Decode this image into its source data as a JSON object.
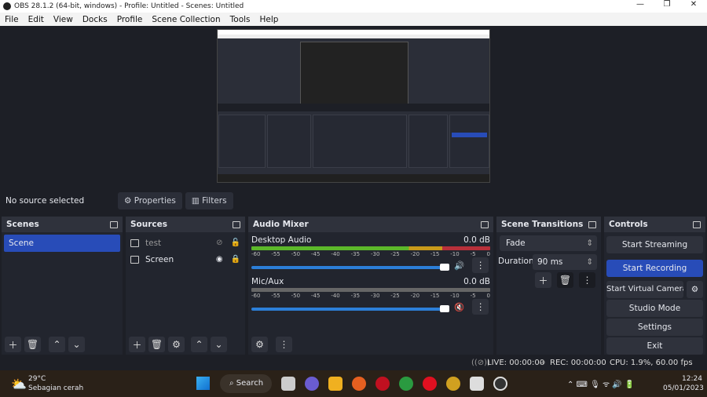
{
  "window": {
    "title": "OBS 28.1.2 (64-bit, windows) - Profile: Untitled - Scenes: Untitled",
    "controls": [
      "—",
      "❐",
      "✕"
    ]
  },
  "menu": [
    "File",
    "Edit",
    "View",
    "Docks",
    "Profile",
    "Scene Collection",
    "Tools",
    "Help"
  ],
  "source_toolbar": {
    "status": "No source selected",
    "properties": "Properties",
    "filters": "Filters"
  },
  "scenes": {
    "title": "Scenes",
    "items": [
      "Scene"
    ]
  },
  "sources": {
    "title": "Sources",
    "items": [
      {
        "name": "test",
        "visible": false,
        "locked": false
      },
      {
        "name": "Screen",
        "visible": true,
        "locked": true
      }
    ]
  },
  "audio_mixer": {
    "title": "Audio Mixer",
    "channels": [
      {
        "name": "Desktop Audio",
        "db": "0.0 dB",
        "muted": false
      },
      {
        "name": "Mic/Aux",
        "db": "0.0 dB",
        "muted": true
      }
    ],
    "ticks": [
      "-60",
      "-55",
      "-50",
      "-45",
      "-40",
      "-35",
      "-30",
      "-25",
      "-20",
      "-15",
      "-10",
      "-5",
      "0"
    ]
  },
  "transitions": {
    "title": "Scene Transitions",
    "selected": "Fade",
    "duration_label": "Duration",
    "duration": "90 ms"
  },
  "controls": {
    "title": "Controls",
    "buttons": [
      "Start Streaming",
      "Start Recording",
      "Start Virtual Camera",
      "Studio Mode",
      "Settings",
      "Exit"
    ],
    "accent": "#284cb8"
  },
  "status": {
    "live": "LIVE: 00:00:00",
    "rec": "REC: 00:00:00",
    "cpu": "CPU: 1.9%, 60.00 fps"
  },
  "taskbar": {
    "temp": "29°C",
    "weather": "Sebagian cerah",
    "search": "Search",
    "time": "12:24",
    "date": "05/01/2023"
  }
}
